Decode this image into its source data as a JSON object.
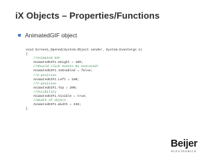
{
  "slide": {
    "title": "iX Objects – Properties/Functions",
    "bullet": "AnimatedGIF object",
    "code_lines": [
      {
        "text": "void Screen1_Opened(System.Object sender, System.EventArgs e)",
        "kind": "code"
      },
      {
        "text": "{",
        "kind": "code"
      },
      {
        "text": "    //Animated GIF",
        "kind": "comment"
      },
      {
        "text": "    AnimatedGIF1.Height = 100;",
        "kind": "code"
      },
      {
        "text": "    //Should click events be executed?",
        "kind": "comment"
      },
      {
        "text": "    AnimatedGIF1.IsEnabled = false;",
        "kind": "code"
      },
      {
        "text": "    //X-position",
        "kind": "comment"
      },
      {
        "text": "    AnimatedGIF1.Left = 100;",
        "kind": "code"
      },
      {
        "text": "    //Y-position",
        "kind": "comment"
      },
      {
        "text": "    AnimatedGIF1.Top = 200;",
        "kind": "code"
      },
      {
        "text": "    //Visibility",
        "kind": "comment"
      },
      {
        "text": "    AnimatedGIF1.Visible = true;",
        "kind": "code"
      },
      {
        "text": "    //Width of object",
        "kind": "comment"
      },
      {
        "text": "    AnimatedGIF1.Width = 236;",
        "kind": "code"
      },
      {
        "text": "}",
        "kind": "code"
      }
    ],
    "logo": {
      "name": "Beijer",
      "subtitle": "ELECTRONICS"
    },
    "colors": {
      "title": "#2f2f2f",
      "bullet_marker": "#4a7ec0",
      "code": "#2a2a2a",
      "comment": "#3f8c5a",
      "logo": "#1a1a1a"
    }
  }
}
